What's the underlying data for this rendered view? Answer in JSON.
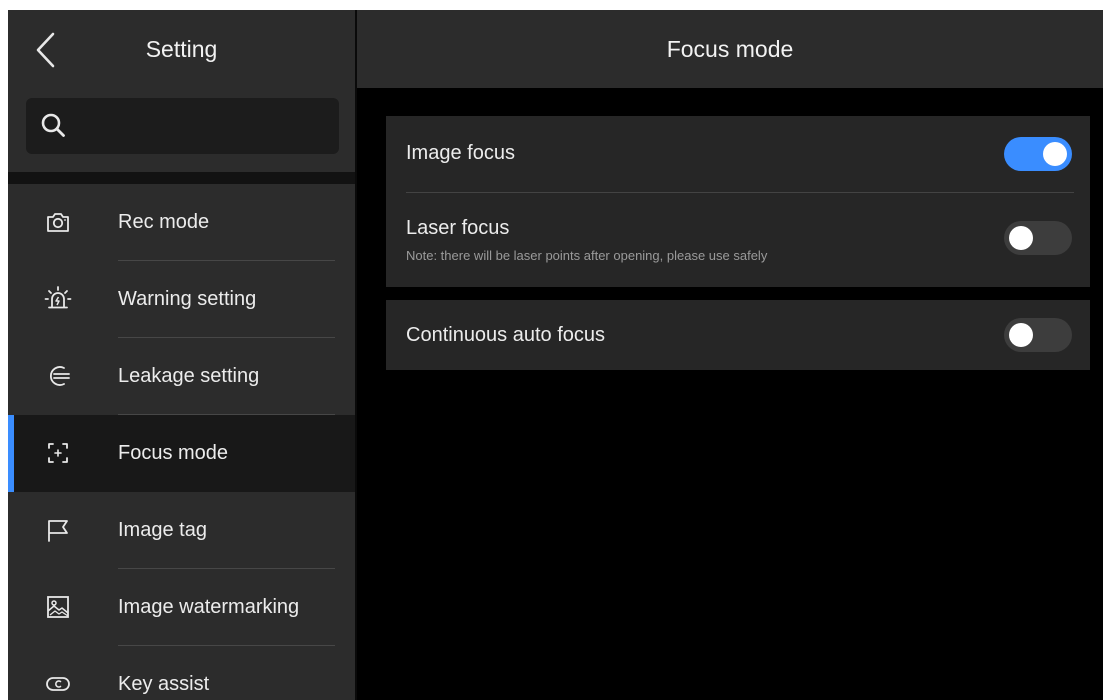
{
  "sidebar": {
    "title": "Setting",
    "back_icon": "chevron-left-icon",
    "search": {
      "placeholder": "",
      "value": "",
      "icon": "search-icon"
    },
    "items": [
      {
        "label": "Rec mode",
        "icon": "camera-icon",
        "active": false
      },
      {
        "label": "Warning setting",
        "icon": "alarm-light-icon",
        "active": false
      },
      {
        "label": "Leakage setting",
        "icon": "wind-icon",
        "active": false
      },
      {
        "label": "Focus mode",
        "icon": "focus-icon",
        "active": true
      },
      {
        "label": "Image tag",
        "icon": "flag-icon",
        "active": false
      },
      {
        "label": "Image watermarking",
        "icon": "image-icon",
        "active": false
      },
      {
        "label": "Key assist",
        "icon": "key-assist-icon",
        "active": false
      }
    ]
  },
  "main": {
    "title": "Focus mode",
    "settings": {
      "image_focus": {
        "label": "Image focus",
        "enabled": true
      },
      "laser_focus": {
        "label": "Laser focus",
        "note": "Note: there will be laser points after opening, please use safely",
        "enabled": false
      },
      "continuous_auto_focus": {
        "label": "Continuous auto focus",
        "enabled": false
      }
    }
  },
  "colors": {
    "accent": "#3a8dff",
    "panel": "#2c2c2c",
    "card": "#262626",
    "background": "#000000"
  }
}
